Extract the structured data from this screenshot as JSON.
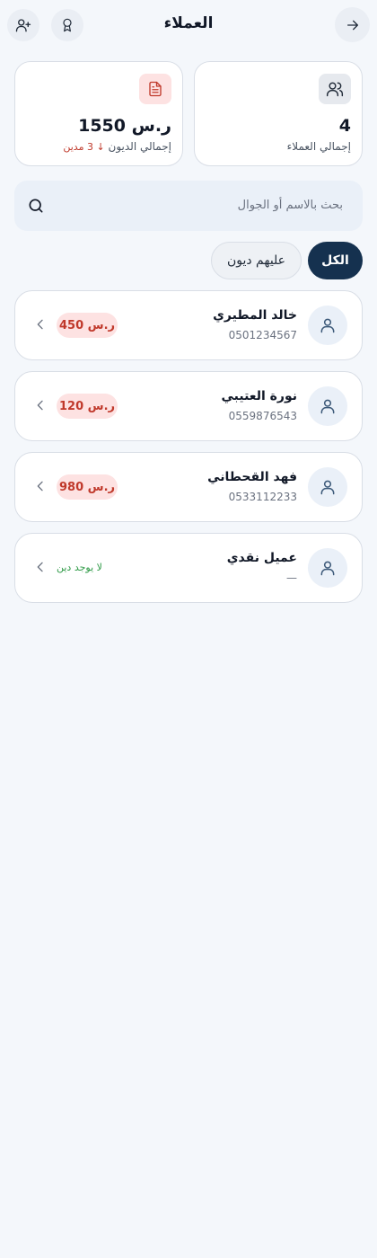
{
  "header": {
    "title": "العملاء",
    "back_icon": "arrow-right-icon",
    "award_icon": "award-icon",
    "add_user_icon": "user-plus-icon"
  },
  "stats": {
    "customers": {
      "value": "4",
      "label": "إجمالي العملاء",
      "icon": "users-icon"
    },
    "debts": {
      "value": "ر.س 1550",
      "label": "إجمالي الديون",
      "sub": "↓ 3 مدين",
      "icon": "document-icon"
    }
  },
  "search": {
    "placeholder": "بحث بالاسم أو الجوال",
    "icon": "search-icon"
  },
  "tabs": [
    {
      "label": "الكل",
      "active": true
    },
    {
      "label": "عليهم ديون",
      "active": false
    }
  ],
  "customers": [
    {
      "name": "خالد المطيري",
      "phone": "0501234567",
      "debt": "ر.س 450"
    },
    {
      "name": "نورة العتيبي",
      "phone": "0559876543",
      "debt": "ر.س 120"
    },
    {
      "name": "فهد القحطاني",
      "phone": "0533112233",
      "debt": "ر.س 980"
    },
    {
      "name": "عميل نقدي",
      "phone": "—",
      "no_debt": "لا يوجد دين"
    }
  ],
  "colors": {
    "primary": "#15314f",
    "debt_red": "#c0392b",
    "debt_bg": "#fde2e2",
    "ok_green": "#2e9a46",
    "background": "#f4f7fb"
  }
}
